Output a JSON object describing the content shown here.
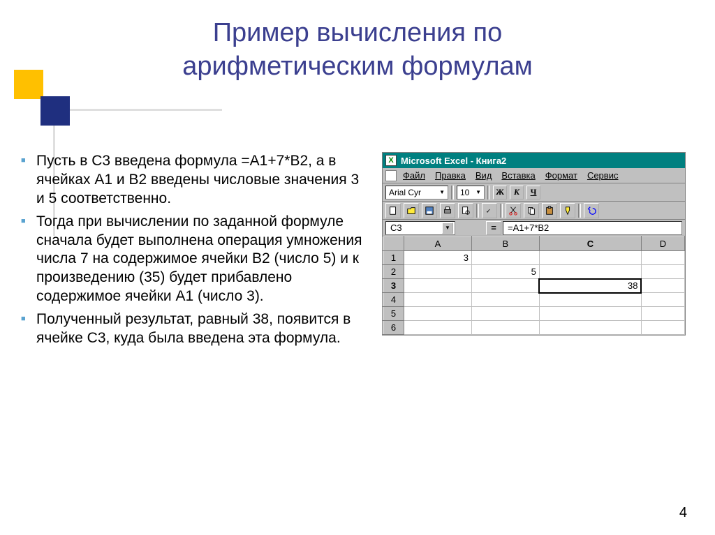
{
  "title_line1": "Пример вычисления по",
  "title_line2": "арифметическим формулам",
  "bullets": [
    "Пусть в С3 введена формула =А1+7*В2, а в ячейках А1 и В2 введены числовые значения 3 и 5 соответственно.",
    "Тогда при вычислении по заданной формуле сначала будет выполнена операция умножения числа 7 на содержимое ячейки В2 (число 5) и к произведению (35) будет прибавлено содержимое ячейки А1 (число 3).",
    "Полученный результат, равный 38, появится в ячейке С3, куда была введена эта формула."
  ],
  "excel": {
    "titlebar": "Microsoft Excel - Книга2",
    "menus": [
      "Файл",
      "Правка",
      "Вид",
      "Вставка",
      "Формат",
      "Сервис"
    ],
    "font_name": "Arial Cyr",
    "font_size": "10",
    "format_buttons": [
      "Ж",
      "К",
      "Ч"
    ],
    "name_box": "C3",
    "formula": "=A1+7*B2",
    "columns": [
      "A",
      "B",
      "C",
      "D"
    ],
    "rows": [
      "1",
      "2",
      "3",
      "4",
      "5",
      "6"
    ],
    "cells": {
      "A1": "3",
      "B2": "5",
      "C3": "38"
    },
    "selected_cell": "C3"
  },
  "page_number": "4"
}
